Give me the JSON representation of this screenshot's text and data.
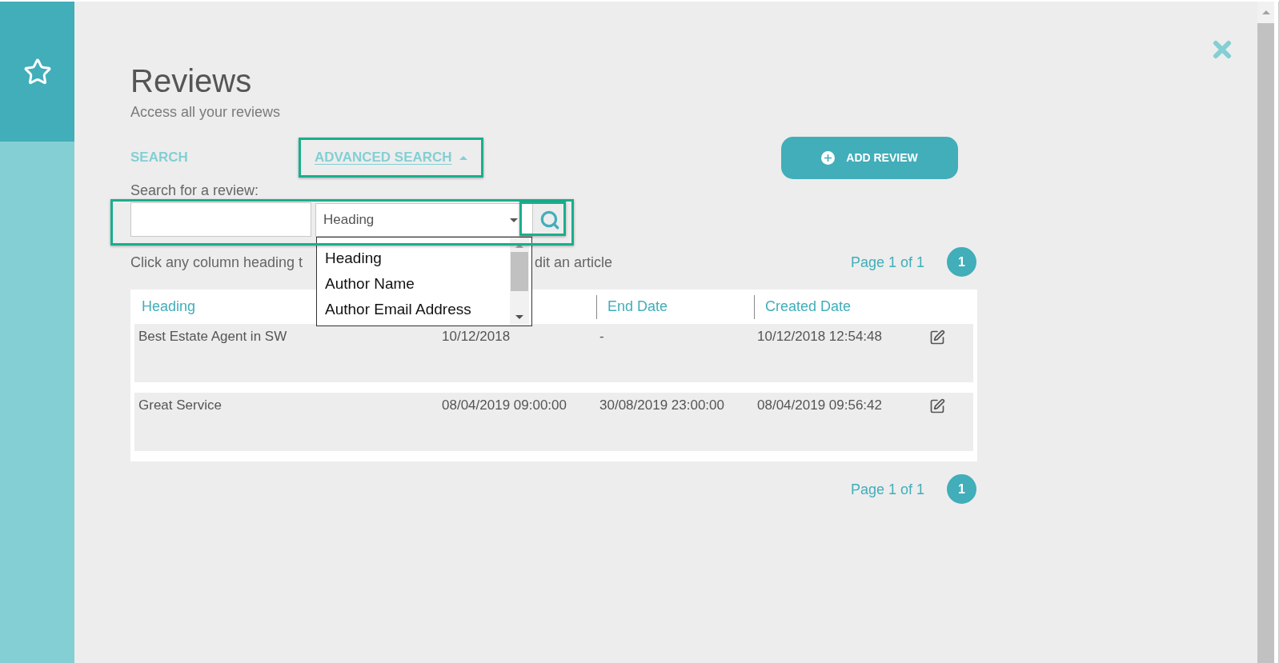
{
  "header": {
    "title": "Reviews",
    "subtitle": "Access all your reviews"
  },
  "tabs": [
    {
      "label": "SEARCH",
      "selected": false,
      "highlighted": false
    },
    {
      "label": "ADVANCED SEARCH",
      "selected": true,
      "highlighted": true
    }
  ],
  "add_button": {
    "label": "ADD REVIEW"
  },
  "search": {
    "label": "Search for a review:",
    "highlighted": true,
    "select": {
      "value": "Heading",
      "expanded": true,
      "options": [
        "Heading",
        "Author Name",
        "Author Email Address"
      ]
    },
    "search_button": {
      "highlighted": true
    }
  },
  "help_text_parts": [
    "Click any column heading t",
    "dit an article"
  ],
  "pagination_top": {
    "text": "Page 1 of 1",
    "pages": [
      {
        "label": "1",
        "selected": true
      }
    ]
  },
  "table": {
    "columns": [
      {
        "label": "Heading"
      },
      {
        "label": "End Date"
      },
      {
        "label": "Created Date"
      }
    ],
    "rows": [
      {
        "heading": "Best Estate Agent in SW",
        "column_2": "10/12/2018",
        "end_date": "-",
        "created_date": "10/12/2018 12:54:48"
      },
      {
        "heading": "Great Service",
        "column_2": "08/04/2019 09:00:00",
        "end_date": "30/08/2019 23:00:00",
        "created_date": "08/04/2019 09:56:42"
      }
    ]
  },
  "pagination_bottom": {
    "text": "Page 1 of 1",
    "pages": [
      {
        "label": "1",
        "selected": true
      }
    ]
  }
}
